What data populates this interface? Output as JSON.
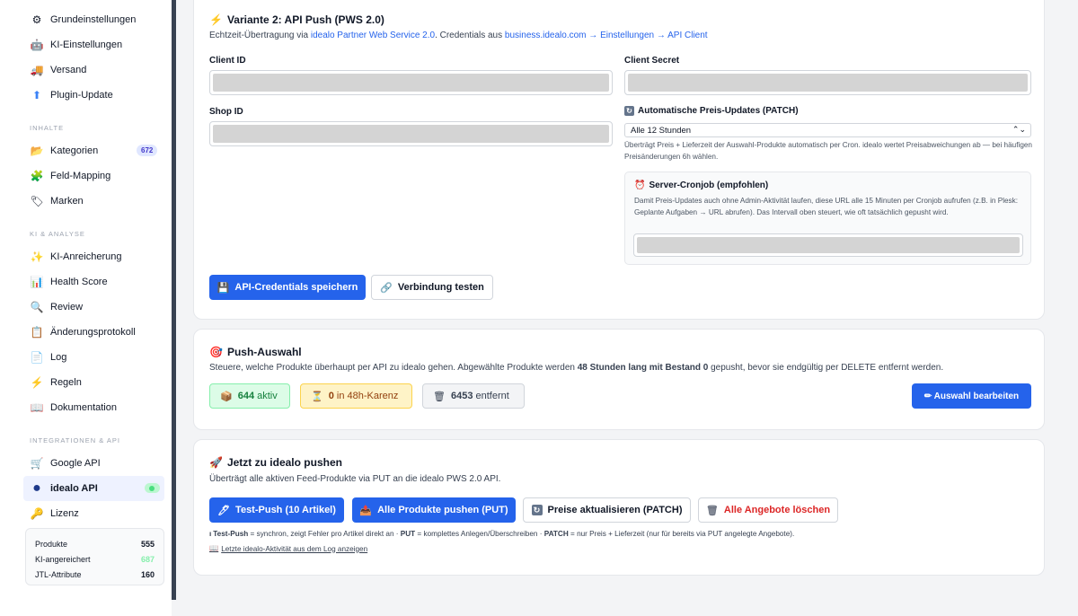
{
  "sidebar": {
    "top_items": [
      {
        "label": "Grundeinstellungen",
        "icon": "⚙"
      },
      {
        "label": "KI-Einstellungen",
        "icon": "🤖"
      },
      {
        "label": "Versand",
        "icon": "🚚"
      },
      {
        "label": "Plugin-Update",
        "icon": "⬆"
      }
    ],
    "section_inhalte": "INHALTE",
    "inhalte_items": [
      {
        "label": "Kategorien",
        "icon": "📂",
        "badge": "672"
      },
      {
        "label": "Feld-Mapping",
        "icon": "🧩"
      },
      {
        "label": "Marken",
        "icon": "🏷"
      }
    ],
    "section_ki": "KI & ANALYSE",
    "ki_items": [
      {
        "label": "KI-Anreicherung",
        "icon": "✨"
      },
      {
        "label": "Health Score",
        "icon": "📊"
      },
      {
        "label": "Review",
        "icon": "🔍"
      },
      {
        "label": "Änderungsprotokoll",
        "icon": "📋"
      },
      {
        "label": "Log",
        "icon": "📄"
      },
      {
        "label": "Regeln",
        "icon": "⚡"
      },
      {
        "label": "Dokumentation",
        "icon": "📖"
      }
    ],
    "section_integrationen": "INTEGRATIONEN & API",
    "integration_items": [
      {
        "label": "Google API",
        "icon": "🛒"
      },
      {
        "label": "idealo API",
        "icon": "●"
      },
      {
        "label": "Lizenz",
        "icon": "🔑"
      }
    ],
    "stats": [
      {
        "label": "Produkte",
        "value": "555",
        "color": "#111827"
      },
      {
        "label": "KI-angereichert",
        "value": "687",
        "color": "#86efac"
      },
      {
        "label": "JTL-Attribute",
        "value": "160",
        "color": "#111827"
      }
    ]
  },
  "variant2": {
    "title": "Variante 2: API Push (PWS 2.0)",
    "desc_prefix": "Echtzeit-Übertragung via ",
    "desc_link1": "idealo Partner Web Service 2.0",
    "desc_mid": ". Credentials aus ",
    "desc_link2": "business.idealo.com → Einstellungen → API Client",
    "client_id_label": "Client ID",
    "client_secret_label": "Client Secret",
    "shop_id_label": "Shop ID",
    "auto_update_label": "Automatische Preis-Updates (PATCH)",
    "auto_update_value": "Alle 12 Stunden",
    "auto_update_help": "Überträgt Preis + Lieferzeit der Auswahl-Produkte automatisch per Cron. idealo wertet Preisabweichungen ab — bei häufigen Preisänderungen 6h wählen.",
    "cron_title": "Server-Cronjob (empfohlen)",
    "cron_text": "Damit Preis-Updates auch ohne Admin-Aktivität laufen, diese URL alle 15 Minuten per Cronjob aufrufen (z.B. in Plesk: Geplante Aufgaben → URL abrufen). Das Intervall oben steuert, wie oft tatsächlich gepusht wird.",
    "save_button": "API-Credentials speichern",
    "test_button": "Verbindung testen"
  },
  "push_selection": {
    "title": "Push-Auswahl",
    "desc_prefix": "Steuere, welche Produkte überhaupt per API zu idealo gehen. Abgewählte Produkte werden ",
    "desc_bold": "48 Stunden lang mit Bestand 0",
    "desc_suffix": " gepusht, bevor sie endgültig per DELETE entfernt werden.",
    "active_count": "644",
    "active_label": "aktiv",
    "karenz_count": "0",
    "karenz_label": "in 48h-Karenz",
    "removed_count": "6453",
    "removed_label": "entfernt",
    "edit_button": "✏ Auswahl bearbeiten"
  },
  "push_now": {
    "title": "Jetzt zu idealo pushen",
    "desc": "Überträgt alle aktiven Feed-Produkte via PUT an die idealo PWS 2.0 API.",
    "btn_test": "Test-Push (10 Artikel)",
    "btn_all": "Alle Produkte pushen (PUT)",
    "btn_prices": "Preise aktualisieren (PATCH)",
    "btn_delete": "Alle Angebote löschen",
    "legend_1b": "Test-Push",
    "legend_1": " = synchron, zeigt Fehler pro Artikel direkt an · ",
    "legend_2b": "PUT",
    "legend_2": " = komplettes Anlegen/Überschreiben · ",
    "legend_3b": "PATCH",
    "legend_3": " = nur Preis + Lieferzeit (nur für bereits via PUT angelegte Angebote).",
    "log_link": "Letzte idealo-Aktivität aus dem Log anzeigen"
  }
}
